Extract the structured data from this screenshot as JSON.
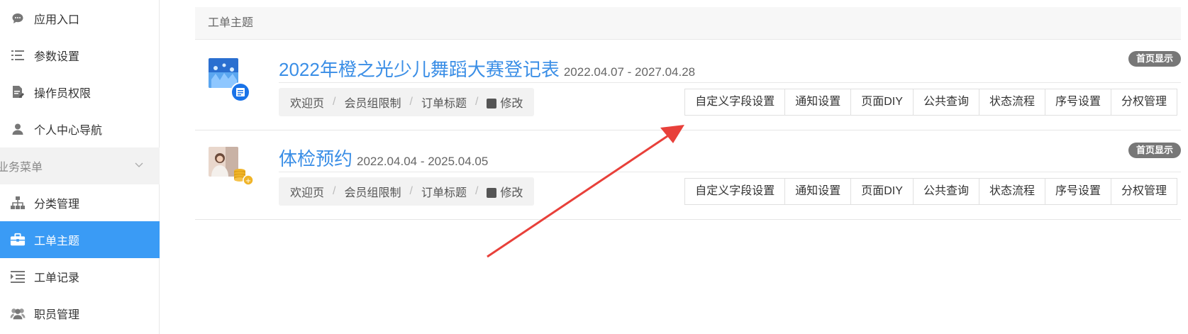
{
  "sidebar": {
    "items": [
      {
        "label": "应用入口",
        "icon": "chat-bubble-icon"
      },
      {
        "label": "参数设置",
        "icon": "list-settings-icon"
      },
      {
        "label": "操作员权限",
        "icon": "document-edit-icon"
      },
      {
        "label": "个人中心导航",
        "icon": "user-icon"
      }
    ],
    "group_label": "业务菜单",
    "group_items": [
      {
        "label": "分类管理",
        "icon": "hierarchy-icon"
      },
      {
        "label": "工单主题",
        "icon": "briefcase-icon",
        "active": true
      },
      {
        "label": "工单记录",
        "icon": "list-indent-icon"
      },
      {
        "label": "职员管理",
        "icon": "users-icon"
      }
    ]
  },
  "panel": {
    "title": "工单主题",
    "rows": [
      {
        "title": "2022年橙之光少儿舞蹈大赛登记表",
        "date": "2022.04.07 - 2027.04.28",
        "tag": "首页显示",
        "crumbs": [
          "欢迎页",
          "会员组限制",
          "订单标题",
          "修改"
        ],
        "actions": [
          "自定义字段设置",
          "通知设置",
          "页面DIY",
          "公共查询",
          "状态流程",
          "序号设置",
          "分权管理"
        ]
      },
      {
        "title": "体检预约",
        "date": "2022.04.04 - 2025.04.05",
        "tag": "首页显示",
        "crumbs": [
          "欢迎页",
          "会员组限制",
          "订单标题",
          "修改"
        ],
        "actions": [
          "自定义字段设置",
          "通知设置",
          "页面DIY",
          "公共查询",
          "状态流程",
          "序号设置",
          "分权管理"
        ]
      }
    ]
  },
  "colors": {
    "accent": "#3a9bf5",
    "title": "#3a8ee6",
    "arrow": "#e8403a"
  }
}
